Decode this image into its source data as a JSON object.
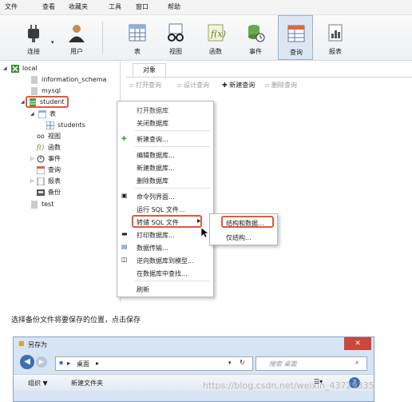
{
  "menubar": [
    "文件",
    "查看",
    "收藏夹",
    "工具",
    "窗口",
    "帮助"
  ],
  "toolbar": [
    {
      "label": "连接",
      "icon": "plug-icon"
    },
    {
      "label": "用户",
      "icon": "user-icon"
    },
    {
      "label": "表",
      "icon": "table-icon"
    },
    {
      "label": "视图",
      "icon": "glasses-icon"
    },
    {
      "label": "函数",
      "icon": "function-icon"
    },
    {
      "label": "事件",
      "icon": "event-clock-icon"
    },
    {
      "label": "查询",
      "icon": "query-icon",
      "selected": true
    },
    {
      "label": "报表",
      "icon": "report-icon"
    }
  ],
  "tree": {
    "connection": "local",
    "databases": [
      "information_schema",
      "mysql",
      "student",
      "test"
    ],
    "student_children": [
      "表",
      "students",
      "视图",
      "函数",
      "事件",
      "查询",
      "报表",
      "备份"
    ]
  },
  "object_tab": "对象",
  "object_toolbar": [
    "打开查询",
    "设计查询",
    "新建查询",
    "删除查询"
  ],
  "context_menu": [
    "打开数据库",
    "关闭数据库",
    "新建查询...",
    "编辑数据库...",
    "新建数据库...",
    "删除数据库",
    "命令列界面...",
    "运行 SQL 文件...",
    "转储 SQL 文件",
    "打印数据库...",
    "数据传输...",
    "逆向数据库到模型...",
    "在数据库中查找...",
    "刷新"
  ],
  "submenu": [
    "结构和数据...",
    "仅结构..."
  ],
  "caption": "选择备份文件将要保存的位置，点击保存",
  "save_dialog": {
    "title": "另存为",
    "path": "桌面",
    "search_placeholder": "搜索 桌面",
    "organize": "组织 ▼",
    "new_folder": "新建文件夹"
  },
  "watermark": "https://blog.csdn.net/weixin_43729335",
  "colors": {
    "highlight": "#e2583e",
    "dialog": "#d6e4f3",
    "tree_db": "#4c9a3d"
  }
}
